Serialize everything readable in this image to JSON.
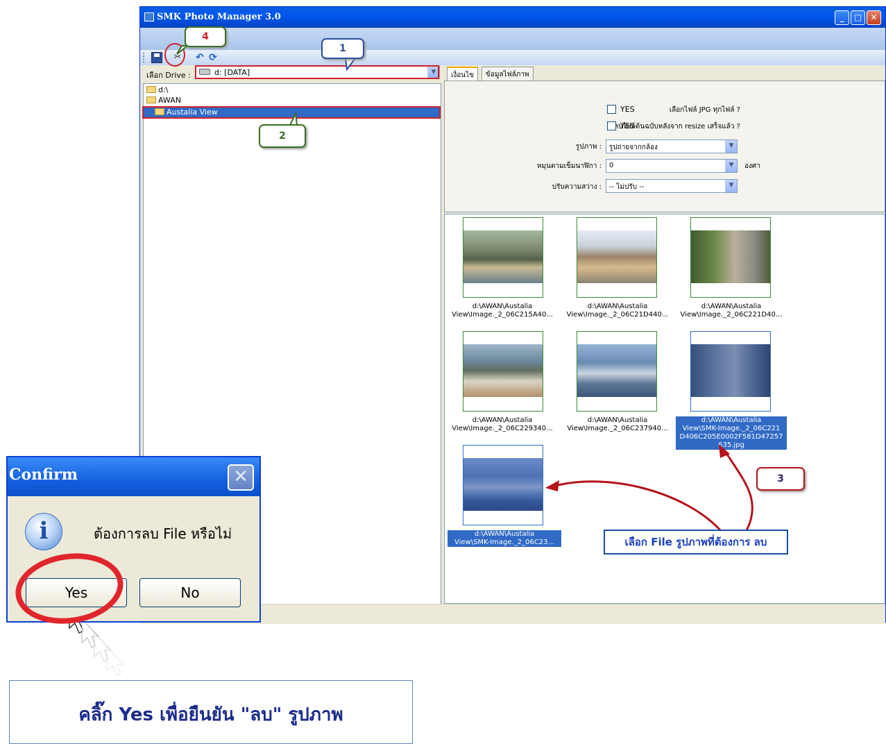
{
  "window": {
    "title": "SMK Photo Manager 3.0"
  },
  "toolbar": {
    "items": [
      "save-icon",
      "cut-icon",
      "undo-icon",
      "refresh-icon"
    ]
  },
  "drive": {
    "label": "เลือก Drive :",
    "value": "d: [DATA]"
  },
  "tree": {
    "items": [
      "d:\\",
      "AWAN",
      "Austalia View"
    ],
    "selected": "Austalia View"
  },
  "tabs": [
    "เงื่อนไข",
    "ข้อมูลไฟล์ภาพ"
  ],
  "conditions": {
    "select_all_label": "เลือกไฟล์ JPG ทุกไฟล์ ?",
    "select_all_value": "YES",
    "delete_original_label": "ลบไฟล์ต้นฉบับหลังจาก resize เสร็จแล้ว ?",
    "delete_original_value": "YES",
    "image_type_label": "รูปภาพ :",
    "image_type_value": "รูปถ่ายจากกล้อง",
    "rotate_label": "หมุนตามเข็มนาฬิกา :",
    "rotate_value": "0",
    "rotate_unit": "องศา",
    "brightness_label": "ปรับความสว่าง :",
    "brightness_value": "-- ไม่ปรับ --"
  },
  "gallery": [
    {
      "line1": "d:\\AWAN\\Austalia",
      "line2": "View\\Image._2_06C215A40...",
      "selected": false
    },
    {
      "line1": "d:\\AWAN\\Austalia",
      "line2": "View\\Image._2_06C21D440...",
      "selected": false
    },
    {
      "line1": "d:\\AWAN\\Austalia",
      "line2": "View\\Image._2_06C221D40...",
      "selected": false
    },
    {
      "line1": "d:\\AWAN\\Austalia",
      "line2": "View\\Image._2_06C229340...",
      "selected": false
    },
    {
      "line1": "d:\\AWAN\\Austalia",
      "line2": "View\\Image._2_06C237940...",
      "selected": false
    },
    {
      "line1": "d:\\AWAN\\Austalia",
      "line2": "View\\SMK-Image._2_06C221",
      "line3": "D406C205E0002F581D47257",
      "line4": "635.jpg",
      "selected": true
    },
    {
      "line1": "d:\\AWAN\\Austalia",
      "line2": "View\\SMK-Image._2_06C23...",
      "selected": true
    }
  ],
  "callouts": {
    "c1": "1",
    "c2": "2",
    "c3": "3",
    "c4": "4"
  },
  "select_note": "เลือก File รูปภาพที่ต้องการ ลบ",
  "confirm": {
    "title": "Confirm",
    "message": "ต้องการลบ File หรือไม่",
    "yes": "Yes",
    "no": "No"
  },
  "bottom_note": "คลิ๊ก Yes เพื่อยืนยัน \"ลบ\" รูปภาพ",
  "colors": {
    "selection": "#316ac5",
    "callout_red": "#d0202a",
    "note_blue": "#1b3fbf"
  }
}
